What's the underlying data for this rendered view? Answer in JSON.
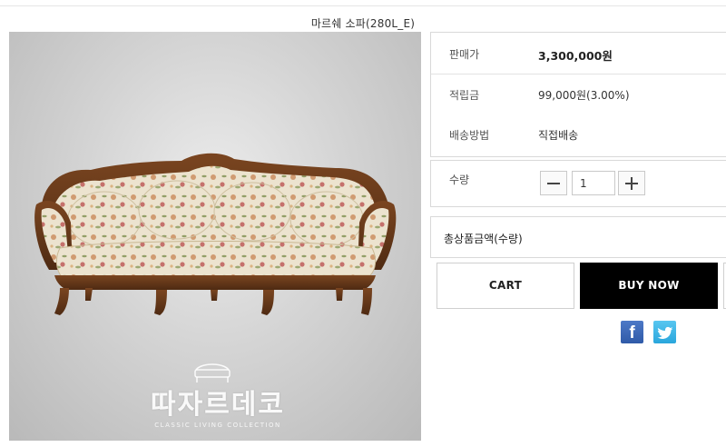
{
  "product": {
    "title": "마르쉐 소파(280L_E)",
    "brand_logo": {
      "name": "따자르데코",
      "tagline": "CLASSIC LIVING COLLECTION"
    }
  },
  "info": {
    "rows": [
      {
        "label": "판매가",
        "value": "3,300,000원"
      },
      {
        "label": "적립금",
        "value": "99,000원(3.00%)"
      },
      {
        "label": "배송방법",
        "value": "직접배송"
      }
    ]
  },
  "quantity": {
    "label": "수량",
    "value": "1",
    "decrease_icon": "minus-icon",
    "increase_icon": "plus-icon"
  },
  "total": {
    "label": "총상품금액(수량)"
  },
  "actions": {
    "cart_label": "CART",
    "buy_label": "BUY NOW"
  },
  "social": {
    "facebook_icon": "facebook-icon",
    "twitter_icon": "twitter-icon",
    "facebook_color": "#3b64b3",
    "twitter_color": "#3ab4e6"
  }
}
